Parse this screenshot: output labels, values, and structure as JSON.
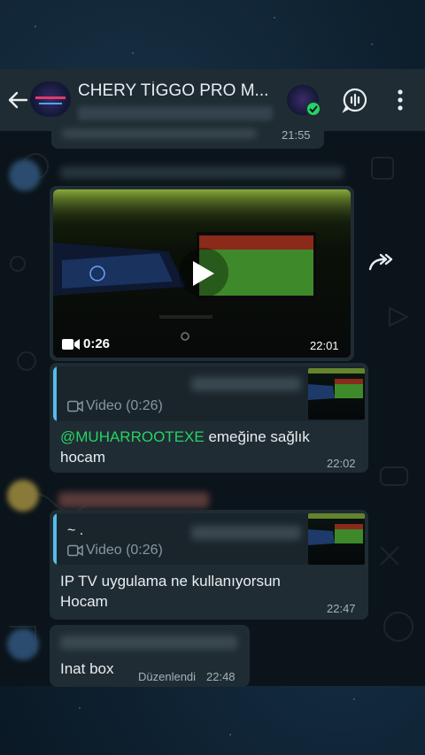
{
  "header": {
    "back_label": "back",
    "title": "CHERY TİGGO PRO M...",
    "icons": [
      "arrow-left-icon",
      "voice-chat-icon",
      "more-vert-icon"
    ]
  },
  "messages": [
    {
      "type": "tail",
      "time": "21:55"
    },
    {
      "type": "video",
      "duration": "0:26",
      "time": "22:01"
    },
    {
      "type": "reply",
      "quote_label": "Video (0:26)",
      "mention": "@MUHARROOTEXE",
      "text_after_mention": " emeğine sağlık",
      "text_line2": "hocam",
      "time": "22:02"
    },
    {
      "type": "reply",
      "quote_sender": "~ .",
      "quote_label": "Video (0:26)",
      "text": "IP TV uygulama ne kullanıyorsun Hocam",
      "time": "22:47"
    },
    {
      "type": "text",
      "text": "Inat box",
      "edited_label": "Düzenlendi",
      "time": "22:48"
    }
  ],
  "colors": {
    "accent_green": "#25d366",
    "quote_bar": "#53bdeb",
    "bubble": "#202c33",
    "header": "#1f2c34"
  }
}
